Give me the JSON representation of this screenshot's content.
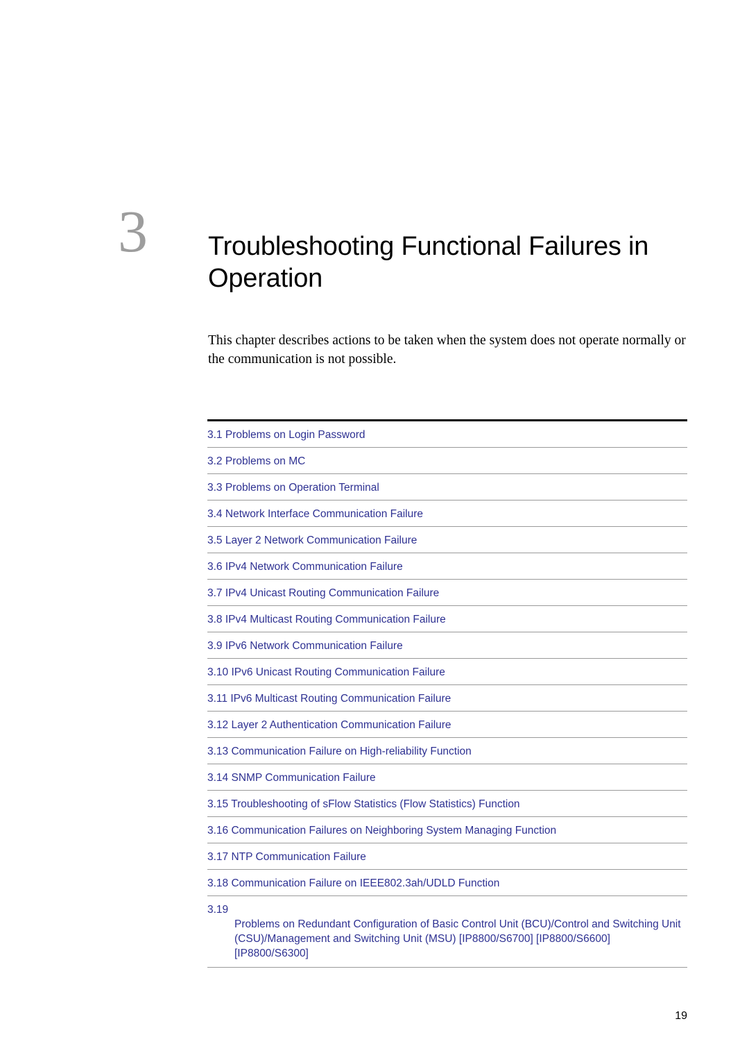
{
  "chapter": {
    "number": "3",
    "title": "Troubleshooting Functional Failures in Operation",
    "intro": "This chapter describes actions to be taken when the system does not operate normally or the communication is not possible."
  },
  "toc": {
    "items": [
      {
        "number": "3.1",
        "label": "Problems on Login Password"
      },
      {
        "number": "3.2",
        "label": "Problems on MC"
      },
      {
        "number": "3.3",
        "label": "Problems on Operation Terminal"
      },
      {
        "number": "3.4",
        "label": "Network Interface Communication Failure"
      },
      {
        "number": "3.5",
        "label": "Layer 2 Network Communication Failure"
      },
      {
        "number": "3.6",
        "label": "IPv4 Network Communication Failure"
      },
      {
        "number": "3.7",
        "label": "IPv4 Unicast Routing Communication Failure"
      },
      {
        "number": "3.8",
        "label": "IPv4 Multicast Routing Communication Failure"
      },
      {
        "number": "3.9",
        "label": "IPv6 Network Communication Failure"
      },
      {
        "number": "3.10",
        "label": "IPv6 Unicast Routing Communication Failure"
      },
      {
        "number": "3.11",
        "label": "IPv6 Multicast Routing Communication Failure"
      },
      {
        "number": "3.12",
        "label": "Layer 2 Authentication Communication Failure"
      },
      {
        "number": "3.13",
        "label": "Communication Failure on High-reliability Function"
      },
      {
        "number": "3.14",
        "label": "SNMP Communication Failure"
      },
      {
        "number": "3.15",
        "label": "Troubleshooting of sFlow Statistics (Flow Statistics) Function"
      },
      {
        "number": "3.16",
        "label": "Communication Failures on Neighboring System Managing Function"
      },
      {
        "number": "3.17",
        "label": "NTP Communication Failure"
      },
      {
        "number": "3.18",
        "label": "Communication Failure on IEEE802.3ah/UDLD Function"
      },
      {
        "number": "3.19",
        "label": "Problems on Redundant Configuration of Basic Control Unit (BCU)/Control and Switching Unit (CSU)/Management and Switching Unit (MSU) [IP8800/S6700] [IP8800/S6600] [IP8800/S6300]"
      }
    ]
  },
  "footer": {
    "page_number": "19"
  }
}
